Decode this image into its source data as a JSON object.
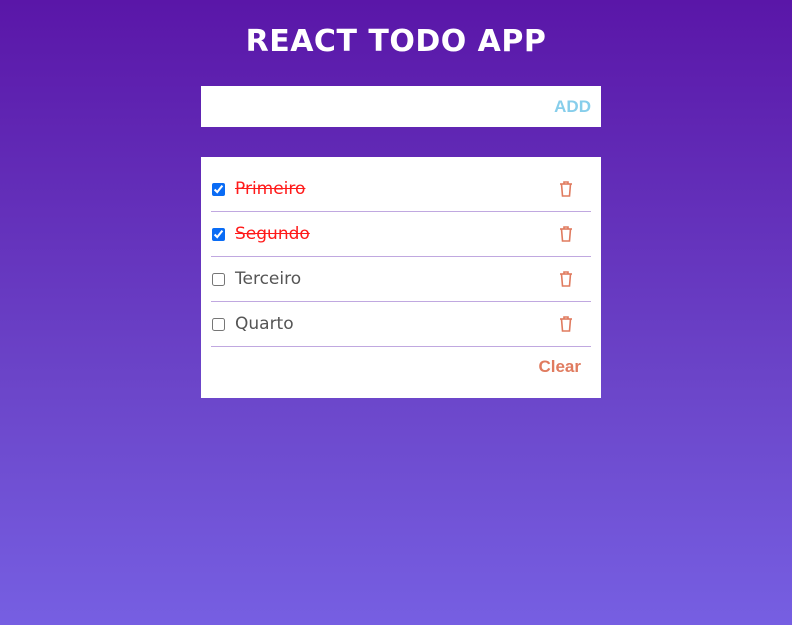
{
  "header": {
    "title": "REACT TODO APP"
  },
  "form": {
    "input_value": "",
    "add_label": "ADD"
  },
  "todos": [
    {
      "label": "Primeiro",
      "done": true
    },
    {
      "label": "Segundo",
      "done": true
    },
    {
      "label": "Terceiro",
      "done": false
    },
    {
      "label": "Quarto",
      "done": false
    }
  ],
  "footer": {
    "clear_label": "Clear"
  },
  "colors": {
    "accent": "#87ceeb",
    "danger": "#e07b5f",
    "done_text": "#ff1a1a"
  }
}
